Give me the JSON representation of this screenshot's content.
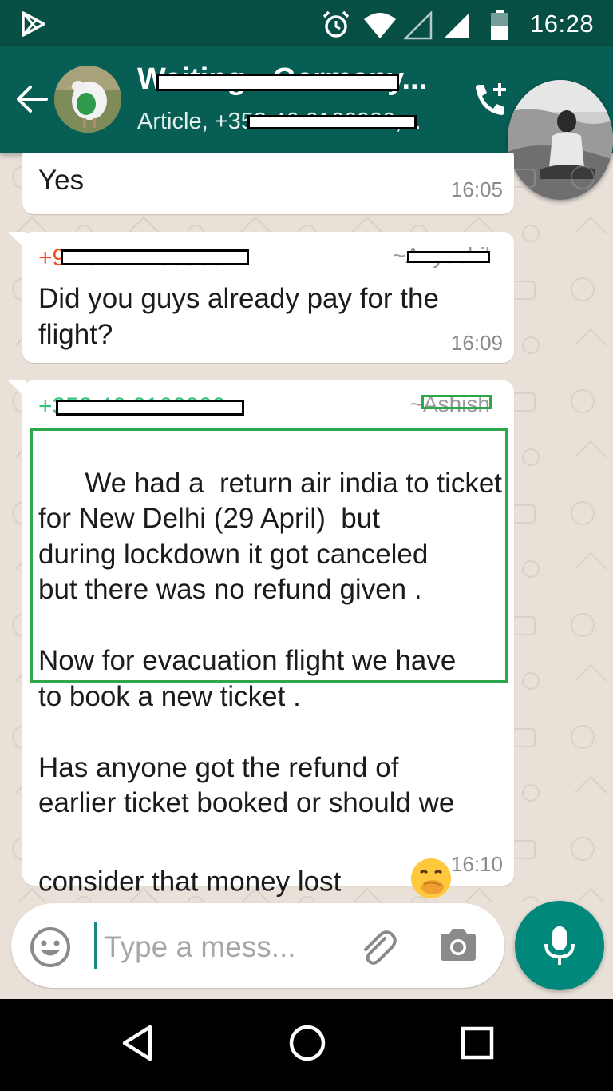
{
  "status_bar": {
    "time": "16:28"
  },
  "header": {
    "group_name": "Waiting - Germany...",
    "subtitle": "Article, +353 46 6166000,..."
  },
  "messages": [
    {
      "text": "Yes",
      "time": "16:05"
    },
    {
      "sender_phone": "+91 99711 00005",
      "sender_name": "~Aayushil",
      "text": "Did you guys already pay for the flight?",
      "time": "16:09"
    },
    {
      "sender_phone": "+353 46 6166000",
      "sender_name": "~Ashish",
      "text": "We had a  return air india to ticket\nfor New Delhi (29 April)  but\nduring lockdown it got canceled\nbut there was no refund given .\n\nNow for evacuation flight we have\nto book a new ticket .\n\nHas anyone got the refund of\nearlier ticket booked or should we\nconsider that money lost",
      "emoji": "face-with-hand-over-mouth",
      "time": "16:10"
    }
  ],
  "composer": {
    "placeholder": "Type a mess..."
  },
  "colors": {
    "header": "#075e54",
    "status_bar": "#074e45",
    "accent": "#00897b",
    "sender_1": "#f4511e",
    "sender_2": "#35c27f",
    "highlight": "#2ea74a"
  },
  "icons": [
    "play-store-icon",
    "alarm-icon",
    "wifi-icon",
    "signal-icon",
    "battery-icon",
    "back-arrow-icon",
    "add-call-icon",
    "emoji-icon",
    "attach-icon",
    "camera-icon",
    "mic-icon",
    "nav-back-icon",
    "nav-home-icon",
    "nav-recents-icon"
  ]
}
